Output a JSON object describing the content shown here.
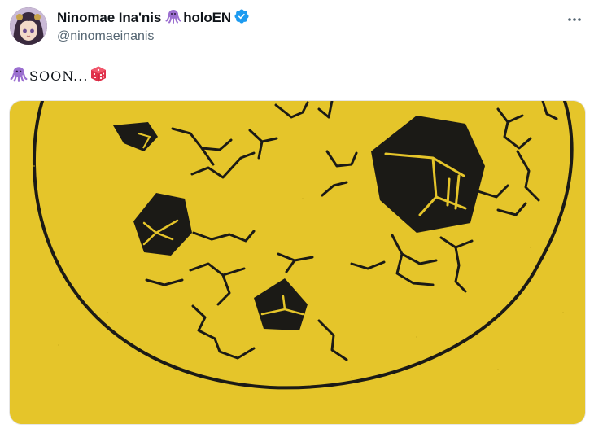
{
  "tweet": {
    "author": {
      "display_name": "Ninomae Ina'nis",
      "affiliation": "holoEN",
      "handle": "@ninomaeinanis",
      "verified": true,
      "icons": [
        "avatar-image",
        "octopus-emoji",
        "verified-badge-icon"
      ]
    },
    "text": {
      "leading_emoji": "octopus-emoji",
      "body": "SOON...",
      "trailing_emoji": "game-die-emoji"
    },
    "more_button": {
      "icon": "more-horizontal-icon"
    },
    "media": {
      "type": "image",
      "description_icon": "cracked-cookie-with-gems",
      "background_color": "#e5c52a",
      "ink_color": "#1b1a16"
    }
  },
  "colors": {
    "octopus": "#9b6fd0",
    "verified_blue": "#1d9bf0",
    "handle_gray": "#536471",
    "die_red": "#e0304a"
  }
}
